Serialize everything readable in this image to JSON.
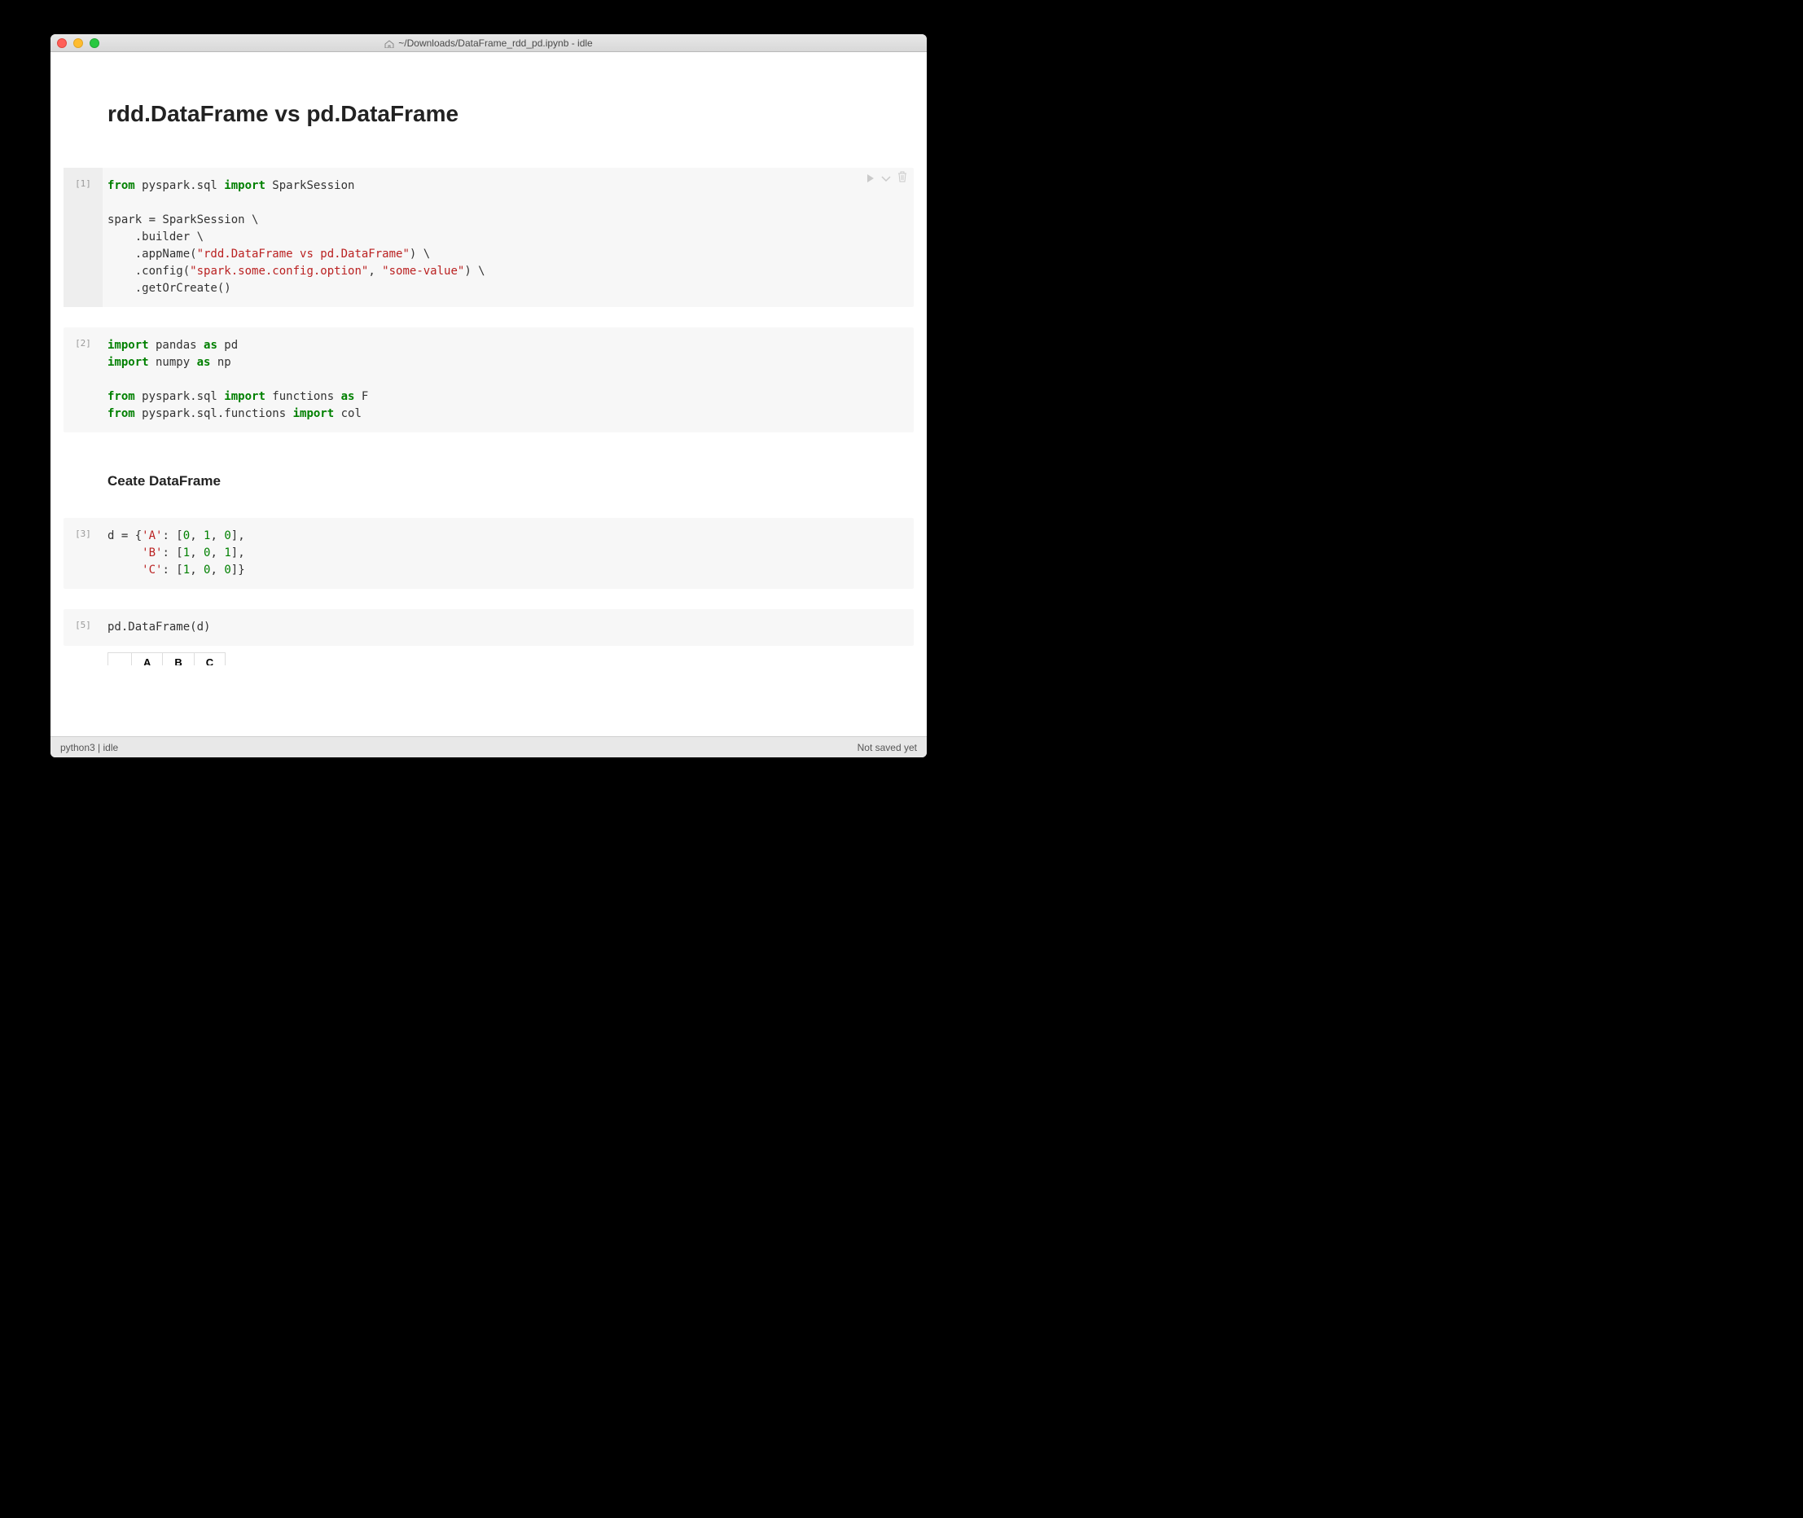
{
  "titlebar": {
    "path": "~/Downloads/DataFrame_rdd_pd.ipynb - idle"
  },
  "headings": {
    "h1": "rdd.DataFrame vs pd.DataFrame",
    "h3_create": "Ceate DataFrame"
  },
  "cells": [
    {
      "prompt": "[1]",
      "code_tokens": [
        {
          "t": "from",
          "c": "kw"
        },
        {
          "t": " pyspark.sql "
        },
        {
          "t": "import",
          "c": "kw"
        },
        {
          "t": " SparkSession\n\nspark = SparkSession \\\n    .builder \\\n    .appName("
        },
        {
          "t": "\"rdd.DataFrame vs pd.DataFrame\"",
          "c": "str"
        },
        {
          "t": ") \\\n    .config("
        },
        {
          "t": "\"spark.some.config.option\"",
          "c": "str"
        },
        {
          "t": ", "
        },
        {
          "t": "\"some-value\"",
          "c": "str"
        },
        {
          "t": ") \\\n    .getOrCreate()"
        }
      ],
      "active": true
    },
    {
      "prompt": "[2]",
      "code_tokens": [
        {
          "t": "import",
          "c": "kw"
        },
        {
          "t": " pandas "
        },
        {
          "t": "as",
          "c": "kw"
        },
        {
          "t": " pd\n"
        },
        {
          "t": "import",
          "c": "kw"
        },
        {
          "t": " numpy "
        },
        {
          "t": "as",
          "c": "kw"
        },
        {
          "t": " np\n\n"
        },
        {
          "t": "from",
          "c": "kw"
        },
        {
          "t": " pyspark.sql "
        },
        {
          "t": "import",
          "c": "kw"
        },
        {
          "t": " functions "
        },
        {
          "t": "as",
          "c": "kw"
        },
        {
          "t": " F\n"
        },
        {
          "t": "from",
          "c": "kw"
        },
        {
          "t": " pyspark.sql.functions "
        },
        {
          "t": "import",
          "c": "kw"
        },
        {
          "t": " col"
        }
      ]
    },
    {
      "prompt": "[3]",
      "code_tokens": [
        {
          "t": "d = {"
        },
        {
          "t": "'A'",
          "c": "str"
        },
        {
          "t": ": ["
        },
        {
          "t": "0",
          "c": "num"
        },
        {
          "t": ", "
        },
        {
          "t": "1",
          "c": "num"
        },
        {
          "t": ", "
        },
        {
          "t": "0",
          "c": "num"
        },
        {
          "t": "],\n     "
        },
        {
          "t": "'B'",
          "c": "str"
        },
        {
          "t": ": ["
        },
        {
          "t": "1",
          "c": "num"
        },
        {
          "t": ", "
        },
        {
          "t": "0",
          "c": "num"
        },
        {
          "t": ", "
        },
        {
          "t": "1",
          "c": "num"
        },
        {
          "t": "],\n     "
        },
        {
          "t": "'C'",
          "c": "str"
        },
        {
          "t": ": ["
        },
        {
          "t": "1",
          "c": "num"
        },
        {
          "t": ", "
        },
        {
          "t": "0",
          "c": "num"
        },
        {
          "t": ", "
        },
        {
          "t": "0",
          "c": "num"
        },
        {
          "t": "]}"
        }
      ]
    },
    {
      "prompt": "[5]",
      "code_tokens": [
        {
          "t": "pd.DataFrame(d)"
        }
      ]
    }
  ],
  "table": {
    "headers": [
      "",
      "A",
      "B",
      "C"
    ]
  },
  "statusbar": {
    "left": "python3 | idle",
    "right": "Not saved yet"
  },
  "icons": {
    "run": "run-icon",
    "expand": "expand-down-icon",
    "trash": "trash-icon"
  }
}
